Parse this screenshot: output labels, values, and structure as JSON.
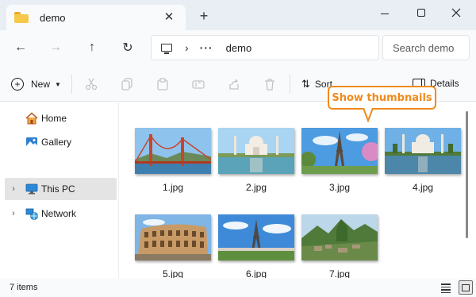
{
  "window": {
    "tab_title": "demo",
    "new_tab": "+",
    "tab_close": "✕"
  },
  "nav": {
    "back": "←",
    "forward": "→",
    "up": "↑",
    "refresh": "↻"
  },
  "address": {
    "separator": "›",
    "overflow": "···",
    "crumb": "demo"
  },
  "search": {
    "placeholder": "Search demo"
  },
  "commands": {
    "new_label": "New",
    "sort_label": "Sort",
    "details_label": "Details",
    "disabled_icons": [
      "cut-icon",
      "copy-icon",
      "paste-icon",
      "rename-icon",
      "share-icon",
      "delete-icon"
    ]
  },
  "callout": {
    "text": "Show thumbnails"
  },
  "sidebar": {
    "items": [
      {
        "label": "Home",
        "icon": "home-icon"
      },
      {
        "label": "Gallery",
        "icon": "gallery-icon"
      },
      {
        "label": "This PC",
        "icon": "pc-icon",
        "selected": true
      },
      {
        "label": "Network",
        "icon": "network-icon"
      }
    ]
  },
  "files": [
    {
      "name": "1.jpg",
      "subject": "golden-gate-bridge"
    },
    {
      "name": "2.jpg",
      "subject": "taj-mahal"
    },
    {
      "name": "3.jpg",
      "subject": "eiffel-tower"
    },
    {
      "name": "4.jpg",
      "subject": "taj-mahal"
    },
    {
      "name": "5.jpg",
      "subject": "colosseum"
    },
    {
      "name": "6.jpg",
      "subject": "eiffel-tower"
    },
    {
      "name": "7.jpg",
      "subject": "machu-picchu"
    }
  ],
  "status": {
    "item_count": "7 items"
  },
  "colors": {
    "accent": "#f08a1c",
    "selection": "#e4e4e4",
    "folder": "#f7c94a"
  }
}
